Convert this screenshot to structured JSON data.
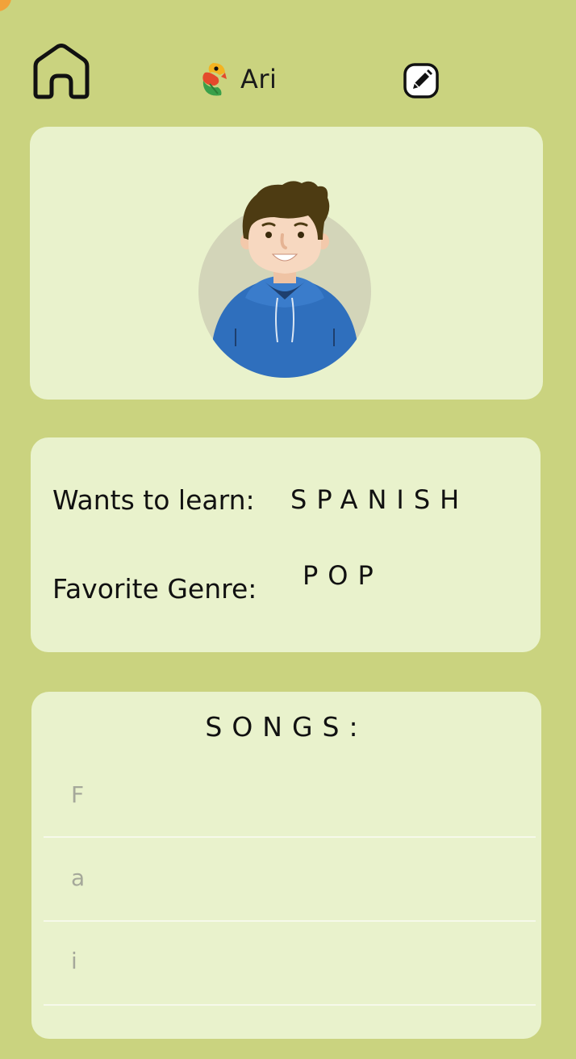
{
  "header": {
    "home_icon": "home-icon",
    "logo_icon": "parrot-logo-icon",
    "user_name": "Ari",
    "edit_icon": "edit-icon"
  },
  "profile": {
    "avatar_icon": "user-avatar"
  },
  "info": {
    "learn_label": "Wants to learn:",
    "learn_value": "SPANISH",
    "genre_label": "Favorite Genre:",
    "genre_value": "POP"
  },
  "songs": {
    "title": "SONGS:",
    "items": [
      "F",
      "a",
      "i"
    ]
  },
  "colors": {
    "background": "#cad37f",
    "card": "#e9f2cc",
    "accent": "#f2a23a"
  }
}
